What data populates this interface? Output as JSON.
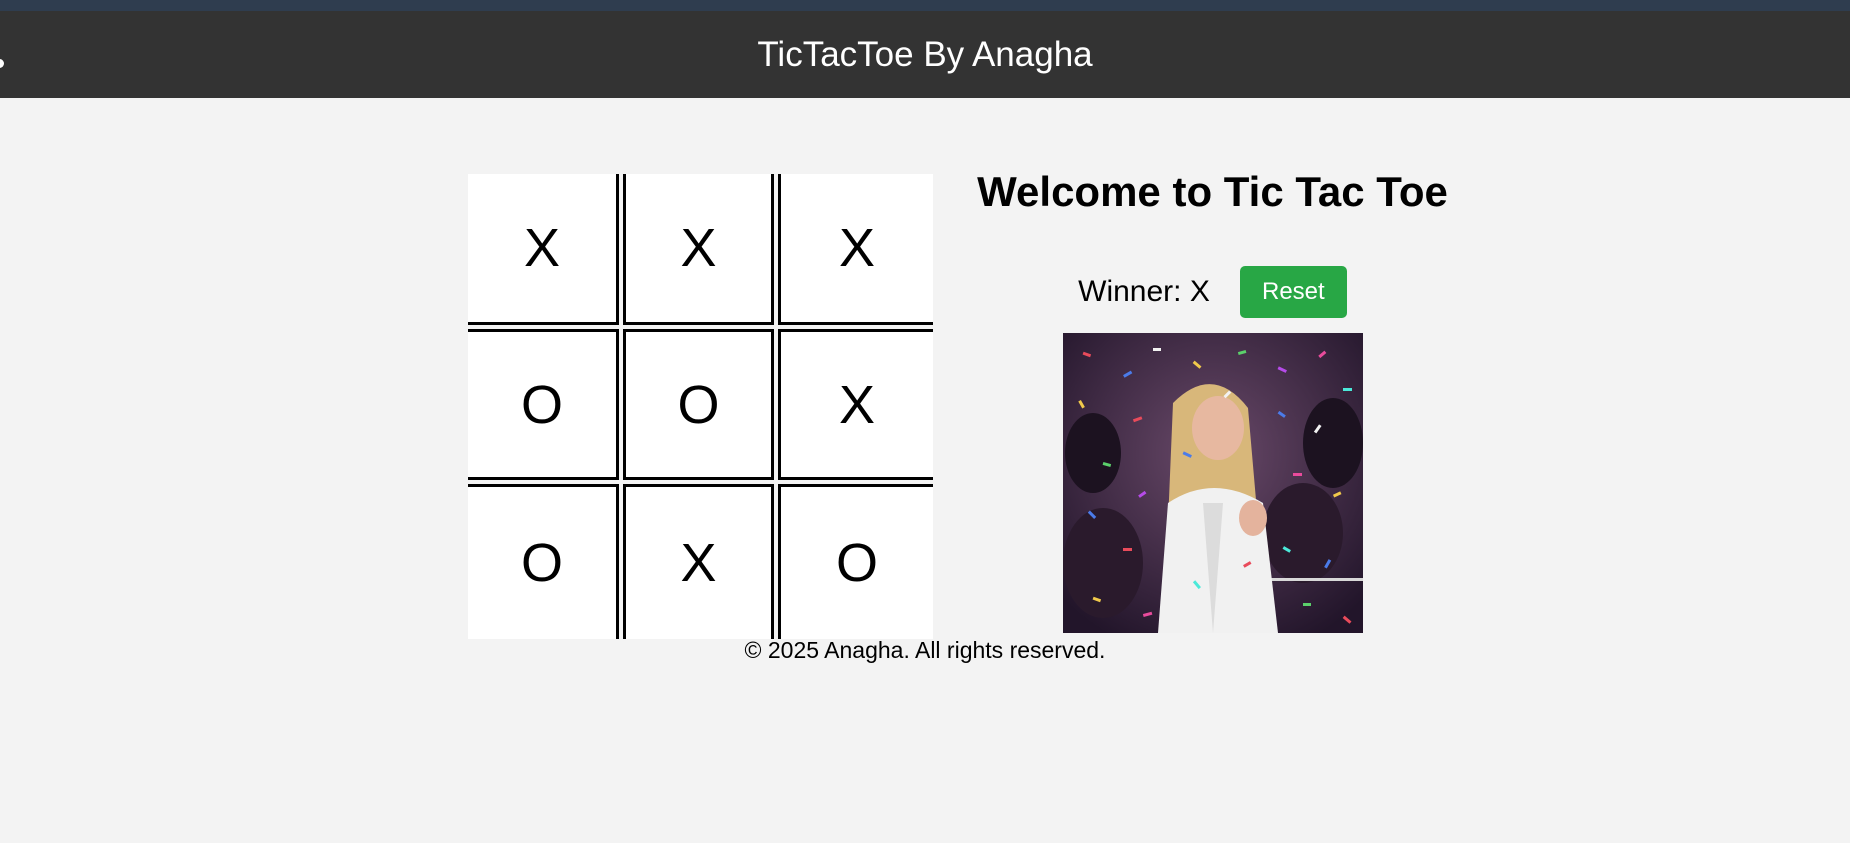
{
  "header": {
    "title": "TicTacToe By Anagha"
  },
  "board": {
    "cells": [
      [
        "X",
        "X",
        "X"
      ],
      [
        "O",
        "O",
        "X"
      ],
      [
        "O",
        "X",
        "O"
      ]
    ]
  },
  "info": {
    "welcome": "Welcome to Tic Tac Toe",
    "winner_text": "Winner: X",
    "reset_label": "Reset"
  },
  "celebration": {
    "icon": "confetti-celebration-image"
  },
  "footer": {
    "text": "© 2025 Anagha. All rights reserved."
  },
  "colors": {
    "header_bg": "#333333",
    "page_bg": "#f3f3f3",
    "reset_bg": "#28a745"
  }
}
